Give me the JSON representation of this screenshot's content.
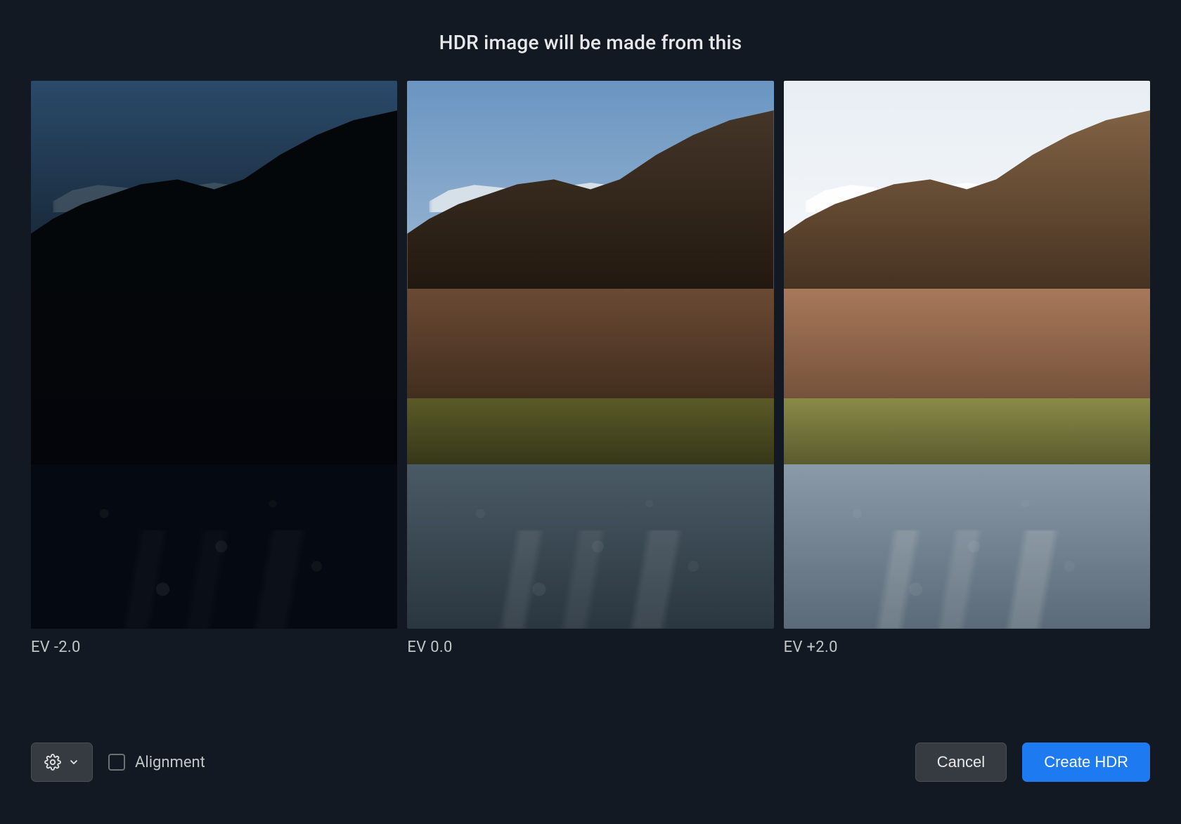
{
  "header": {
    "title": "HDR image will be made from this"
  },
  "exposures": [
    {
      "ev_label": "EV -2.0",
      "ev_value": -2.0,
      "thumb_class": "ev-neg"
    },
    {
      "ev_label": "EV 0.0",
      "ev_value": 0.0,
      "thumb_class": "ev-zero"
    },
    {
      "ev_label": "EV +2.0",
      "ev_value": 2.0,
      "thumb_class": "ev-pos"
    }
  ],
  "footer": {
    "settings_icon": "gear-icon",
    "settings_chevron": "chevron-down-icon",
    "alignment": {
      "label": "Alignment",
      "checked": false
    },
    "cancel_label": "Cancel",
    "create_label": "Create HDR"
  },
  "colors": {
    "background": "#121922",
    "primary": "#1e7af0",
    "button_bg": "#363b41",
    "text": "#e6e8ea"
  }
}
